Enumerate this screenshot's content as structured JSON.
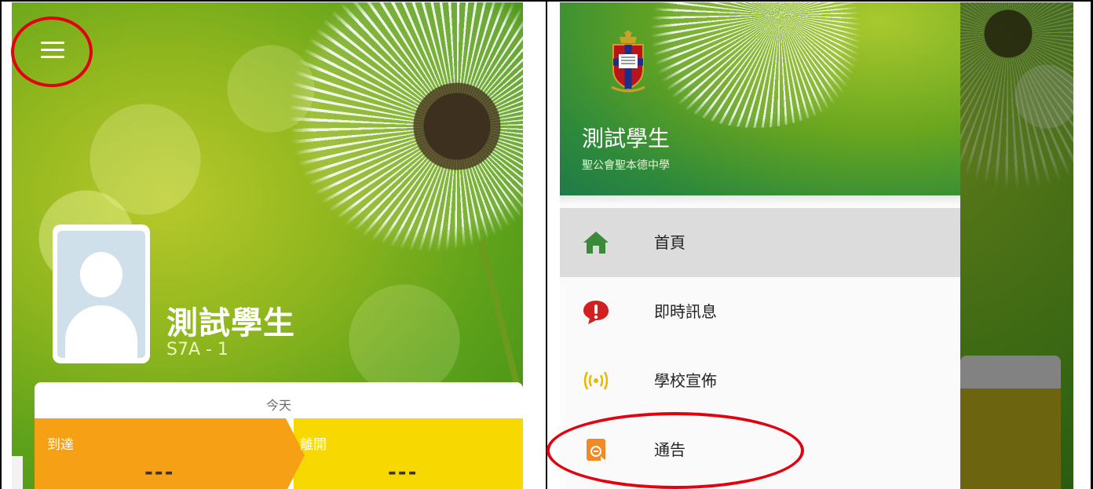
{
  "left_screen": {
    "student": {
      "name": "測試學生",
      "class": "S7A - 1"
    },
    "attendance": {
      "today_label": "今天",
      "arrive_label": "到達",
      "arrive_value": "---",
      "leave_label": "離開",
      "leave_value": "---"
    }
  },
  "right_screen": {
    "drawer": {
      "user_name": "測試學生",
      "school_name": "聖公會聖本德中學",
      "items": [
        {
          "label": "首頁",
          "icon": "home-icon",
          "active": true
        },
        {
          "label": "即時訊息",
          "icon": "alert-message-icon",
          "active": false
        },
        {
          "label": "學校宣佈",
          "icon": "broadcast-icon",
          "active": false
        },
        {
          "label": "通告",
          "icon": "notice-icon",
          "active": false
        }
      ]
    }
  },
  "colors": {
    "annotation_red": "#e3000f",
    "arrive_orange": "#f6a015",
    "leave_yellow": "#f7d800",
    "home_green": "#3a8a3a",
    "message_red": "#d21f1f",
    "broadcast_yellow": "#e8b800",
    "notice_orange": "#f08a24"
  }
}
